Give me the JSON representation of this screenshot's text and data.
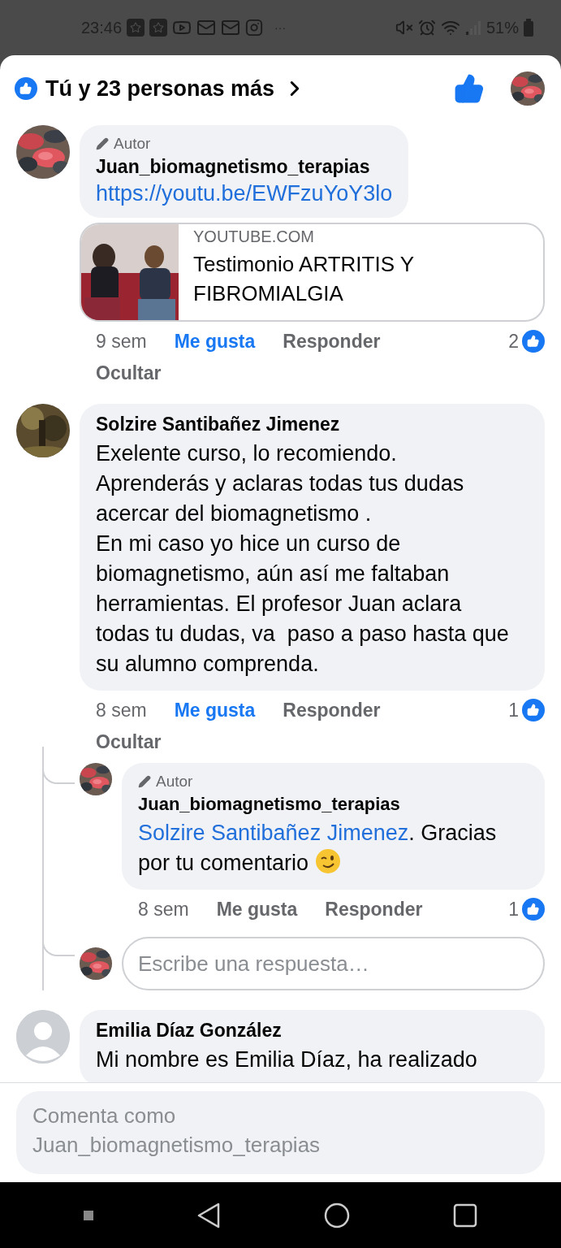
{
  "status_bar": {
    "time": "23:46",
    "more": "···",
    "battery": "51%"
  },
  "header": {
    "label": "Tú y 23 personas más",
    "liked": true
  },
  "comments": [
    {
      "badge": "Autor",
      "author": "Juan_biomagnetismo_terapias",
      "link": "https://youtu.be/EWFzuYoY3lo",
      "preview": {
        "source": "YOUTUBE.COM",
        "title": "Testimonio ARTRITIS Y FIBROMIALGIA"
      },
      "time": "9 sem",
      "like_label": "Me gusta",
      "liked": true,
      "reply_label": "Responder",
      "hide_label": "Ocultar",
      "like_count": "2"
    },
    {
      "author": "Solzire Santibañez Jimenez",
      "paragraphs": [
        "Exelente curso, lo recomiendo.\nAprenderás y aclaras todas tus dudas acercar del biomagnetismo .\nEn mi caso yo hice un curso de biomagnetismo, aún así me faltaban herramientas. El profesor Juan aclara todas tu dudas, va  paso a paso hasta que su alumno comprenda."
      ],
      "time": "8 sem",
      "like_label": "Me gusta",
      "liked": true,
      "reply_label": "Responder",
      "hide_label": "Ocultar",
      "like_count": "1",
      "replies": [
        {
          "badge": "Autor",
          "author": "Juan_biomagnetismo_terapias",
          "segments": [
            {
              "kind": "mention",
              "text": "Solzire Santibañez Jimenez"
            },
            {
              "kind": "text",
              "text": ". Gracias por tu comentario"
            },
            {
              "kind": "emoji"
            }
          ],
          "time": "8 sem",
          "like_label": "Me gusta",
          "liked": false,
          "reply_label": "Responder",
          "like_count": "1"
        }
      ],
      "reply_box": {
        "placeholder": "Escribe una respuesta…"
      }
    },
    {
      "avatar": {
        "kind": "default"
      },
      "author": "Emilia Díaz González",
      "paragraphs": [
        "Mi nombre es Emilia Díaz, ha realizado"
      ]
    }
  ],
  "composer": {
    "placeholder": "Comenta como Juan_biomagnetismo_terapias"
  }
}
